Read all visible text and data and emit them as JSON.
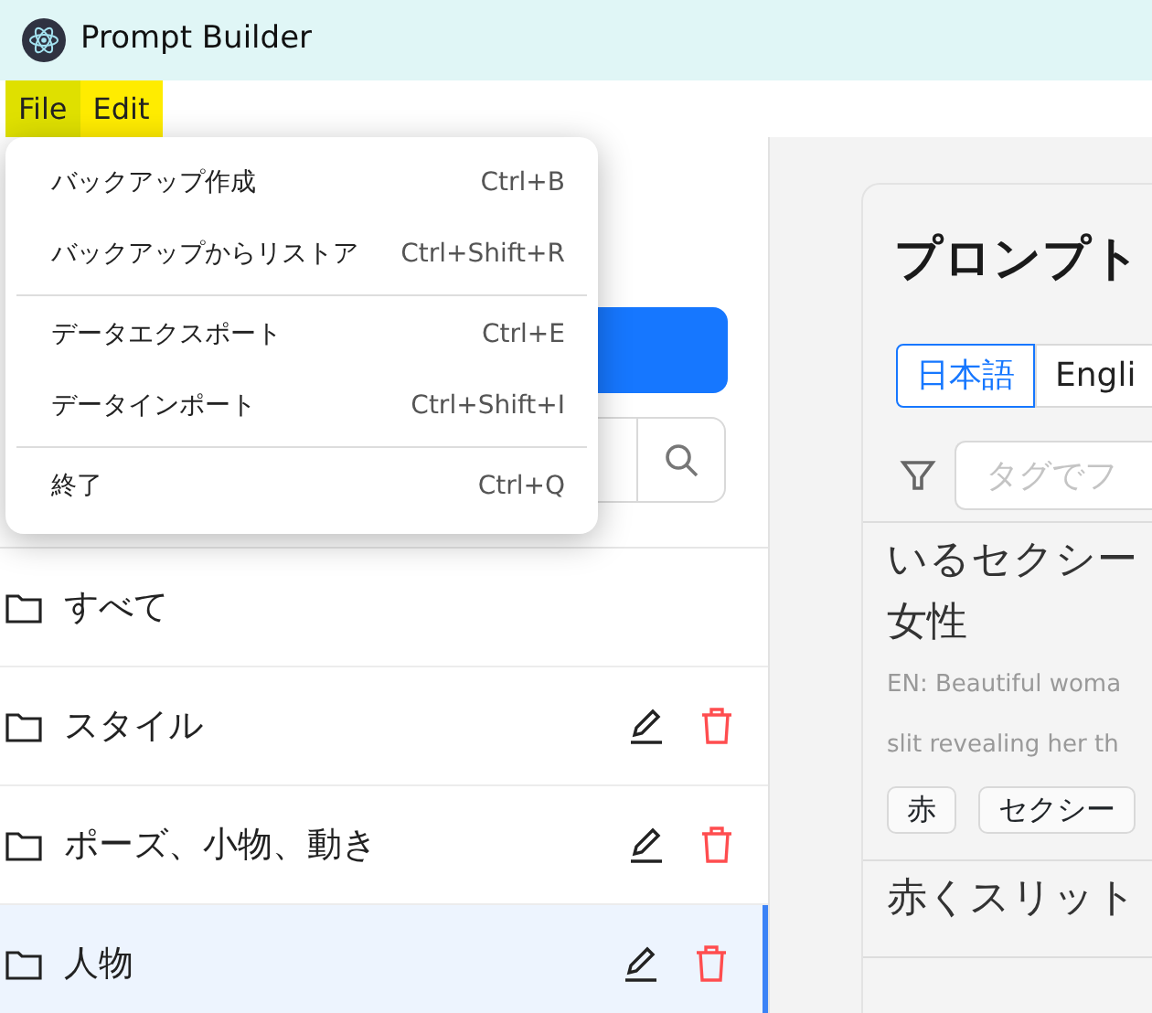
{
  "window": {
    "title": "Prompt Builder"
  },
  "menu_bar": [
    {
      "label": "File",
      "highlighted": true,
      "selected": true
    },
    {
      "label": "Edit",
      "highlighted": true,
      "selected": false
    }
  ],
  "file_menu": [
    {
      "kind": "item",
      "label": "バックアップ作成",
      "shortcut": "Ctrl+B"
    },
    {
      "kind": "item",
      "label": "バックアップからリストア",
      "shortcut": "Ctrl+Shift+R"
    },
    {
      "kind": "separator"
    },
    {
      "kind": "item",
      "label": "データエクスポート",
      "shortcut": "Ctrl+E"
    },
    {
      "kind": "item",
      "label": "データインポート",
      "shortcut": "Ctrl+Shift+I"
    },
    {
      "kind": "separator"
    },
    {
      "kind": "item",
      "label": "終了",
      "shortcut": "Ctrl+Q"
    }
  ],
  "folders": [
    {
      "name": "すべて",
      "editable": false,
      "selected": false
    },
    {
      "name": "スタイル",
      "editable": true,
      "selected": false
    },
    {
      "name": "ポーズ、小物、動き",
      "editable": true,
      "selected": false
    },
    {
      "name": "人物",
      "editable": true,
      "selected": true
    }
  ],
  "main": {
    "title": "プロンプト",
    "languages": [
      {
        "label": "日本語",
        "selected": true
      },
      {
        "label": "Engli",
        "selected": false
      }
    ],
    "tag_filter": {
      "placeholder": "タグでフ"
    },
    "prompts": [
      {
        "title_lines": [
          "いるセクシー",
          "女性"
        ],
        "english_lines": [
          "EN: Beautiful woma",
          "slit revealing her th"
        ],
        "tags": [
          "赤",
          "セクシー"
        ]
      },
      {
        "title_lines": [
          "赤くスリット"
        ]
      }
    ]
  }
}
